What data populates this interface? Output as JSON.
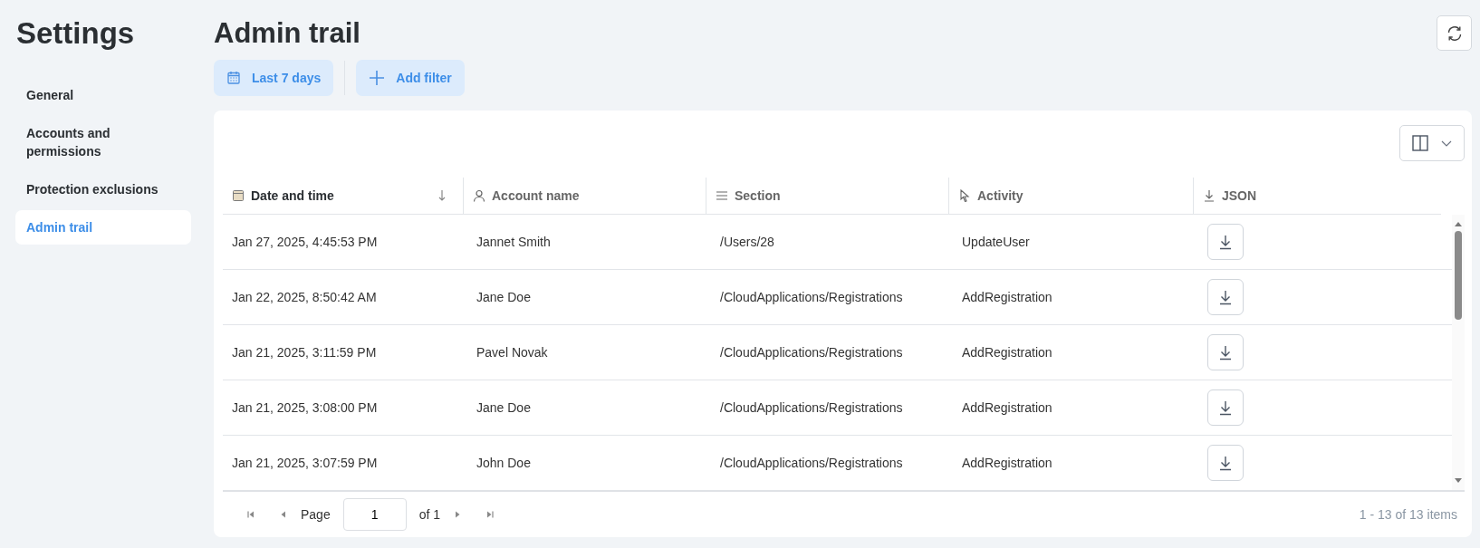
{
  "sidebar": {
    "title": "Settings",
    "items": [
      {
        "label": "General",
        "selected": false
      },
      {
        "label": "Accounts and permissions",
        "selected": false
      },
      {
        "label": "Protection exclusions",
        "selected": false
      },
      {
        "label": "Admin trail",
        "selected": true
      }
    ]
  },
  "page": {
    "title": "Admin trail"
  },
  "filters": {
    "date_range": "Last 7 days",
    "add_filter": "Add filter"
  },
  "table": {
    "columns": [
      {
        "label": "Date and time",
        "sorted": true
      },
      {
        "label": "Account name",
        "sorted": false
      },
      {
        "label": "Section",
        "sorted": false
      },
      {
        "label": "Activity",
        "sorted": false
      },
      {
        "label": "JSON",
        "sorted": false
      }
    ],
    "rows": [
      {
        "date": "Jan 27, 2025, 4:45:53 PM",
        "account": "Jannet Smith",
        "section": "/Users/28",
        "activity": "UpdateUser"
      },
      {
        "date": "Jan 22, 2025, 8:50:42 AM",
        "account": "Jane Doe",
        "section": "/CloudApplications/Registrations",
        "activity": "AddRegistration"
      },
      {
        "date": "Jan 21, 2025, 3:11:59 PM",
        "account": "Pavel Novak",
        "section": "/CloudApplications/Registrations",
        "activity": "AddRegistration"
      },
      {
        "date": "Jan 21, 2025, 3:08:00 PM",
        "account": "Jane Doe",
        "section": "/CloudApplications/Registrations",
        "activity": "AddRegistration"
      },
      {
        "date": "Jan 21, 2025, 3:07:59 PM",
        "account": "John Doe",
        "section": "/CloudApplications/Registrations",
        "activity": "AddRegistration"
      }
    ]
  },
  "pagination": {
    "page_label": "Page",
    "page": "1",
    "of": "of 1",
    "summary": "1 - 13 of 13 items"
  }
}
